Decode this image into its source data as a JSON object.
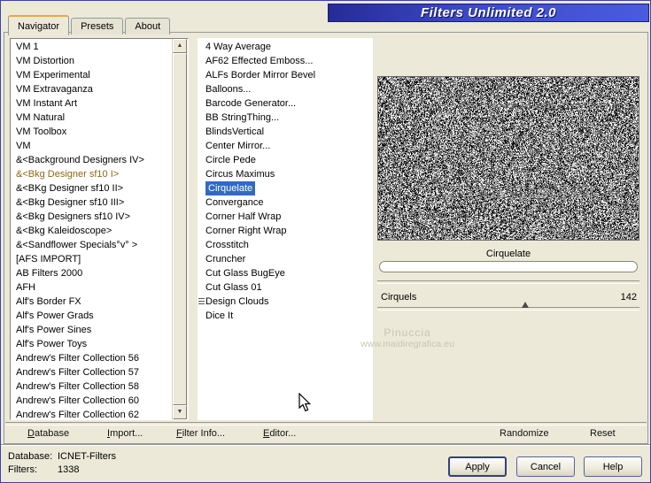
{
  "window": {
    "title": "Filters Unlimited 2.0"
  },
  "tabs": [
    {
      "label": "Navigator"
    },
    {
      "label": "Presets"
    },
    {
      "label": "About"
    }
  ],
  "categories": {
    "selected_index": 9,
    "items": [
      "VM 1",
      "VM Distortion",
      "VM Experimental",
      "VM Extravaganza",
      "VM Instant Art",
      "VM Natural",
      "VM Toolbox",
      "VM",
      "&<Background Designers IV>",
      "&<Bkg Designer sf10 I>",
      "&<BKg Designer sf10 II>",
      "&<Bkg Designer sf10 III>",
      "&<Bkg Designers sf10 IV>",
      "&<Bkg Kaleidoscope>",
      "&<Sandflower Specials°v° >",
      "[AFS IMPORT]",
      "AB Filters 2000",
      "AFH",
      "Alf's Border FX",
      "Alf's Power Grads",
      "Alf's Power Sines",
      "Alf's Power Toys",
      "Andrew's Filter Collection 56",
      "Andrew's Filter Collection 57",
      "Andrew's Filter Collection 58",
      "Andrew's Filter Collection 60",
      "Andrew's Filter Collection 62"
    ]
  },
  "filters": {
    "selected_index": 10,
    "icon_index": 18,
    "items": [
      "4 Way Average",
      "AF62 Effected Emboss...",
      "ALFs Border Mirror Bevel",
      "Balloons...",
      "Barcode Generator...",
      "BB StringThing...",
      "BlindsVertical",
      "Center Mirror...",
      "Circle Pede",
      "Circus Maximus",
      "Cirquelate",
      "Convergance",
      "Corner Half Wrap",
      "Corner Right Wrap",
      "Crosstitch",
      "Cruncher",
      "Cut Glass  BugEye",
      "Cut Glass 01",
      "Design Clouds",
      "Dice It"
    ]
  },
  "preview": {
    "caption": "Cirquelate"
  },
  "parameters": [
    {
      "name": "Cirquels",
      "value": "142",
      "position_pct": 55
    }
  ],
  "watermark": {
    "line1": "Pinuccia",
    "line2": "www.maidiregrafica.eu"
  },
  "toolbar": {
    "items": [
      {
        "label": "Database"
      },
      {
        "label": "Import..."
      },
      {
        "label": "Filter Info..."
      },
      {
        "label": "Editor..."
      },
      {
        "label": "Randomize"
      },
      {
        "label": "Reset"
      }
    ]
  },
  "status": {
    "database_label": "Database:",
    "database_value": "ICNET-Filters",
    "filters_label": "Filters:",
    "filters_value": "1338"
  },
  "action_buttons": {
    "apply": "Apply",
    "cancel": "Cancel",
    "help": "Help"
  },
  "colors": {
    "dialog_bg": "#ECE9D8",
    "selection": "#316AC5",
    "category_selected_text": "#8B6914",
    "titlebar_from": "#262B96",
    "titlebar_to": "#4A5BE0"
  }
}
